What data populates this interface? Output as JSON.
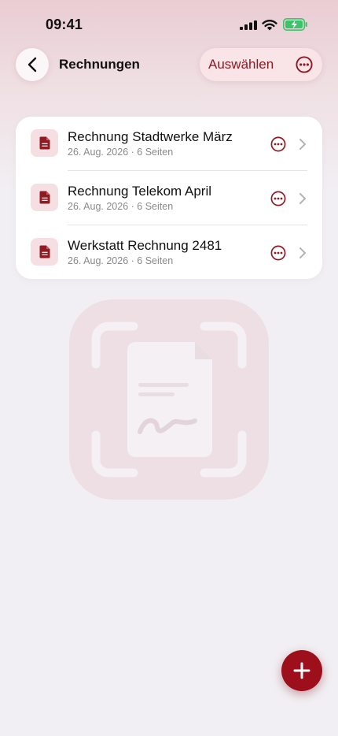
{
  "status_bar": {
    "time": "09:41",
    "icons": [
      "signal-icon",
      "wifi-icon",
      "battery-charging-icon"
    ]
  },
  "nav": {
    "title": "Rechnungen",
    "back_icon": "chevron-left-icon",
    "select_label": "Auswählen",
    "more_icon": "ellipsis-circle-icon"
  },
  "documents": [
    {
      "title": "Rechnung Stadtwerke März",
      "date": "26. Aug. 2026",
      "pages": "6 Seiten"
    },
    {
      "title": "Rechnung Telekom April",
      "date": "26. Aug. 2026",
      "pages": "6 Seiten"
    },
    {
      "title": "Werkstatt Rechnung 2481",
      "date": "26. Aug. 2026",
      "pages": "6 Seiten"
    }
  ],
  "separator": "·",
  "fab_icon": "plus-icon",
  "colors": {
    "accent": "#8e1a22",
    "fab": "#9c0f1b",
    "icon_bg": "#f5dfe2",
    "background": "#f1eff3",
    "header_tint": "#e9cdd3"
  }
}
